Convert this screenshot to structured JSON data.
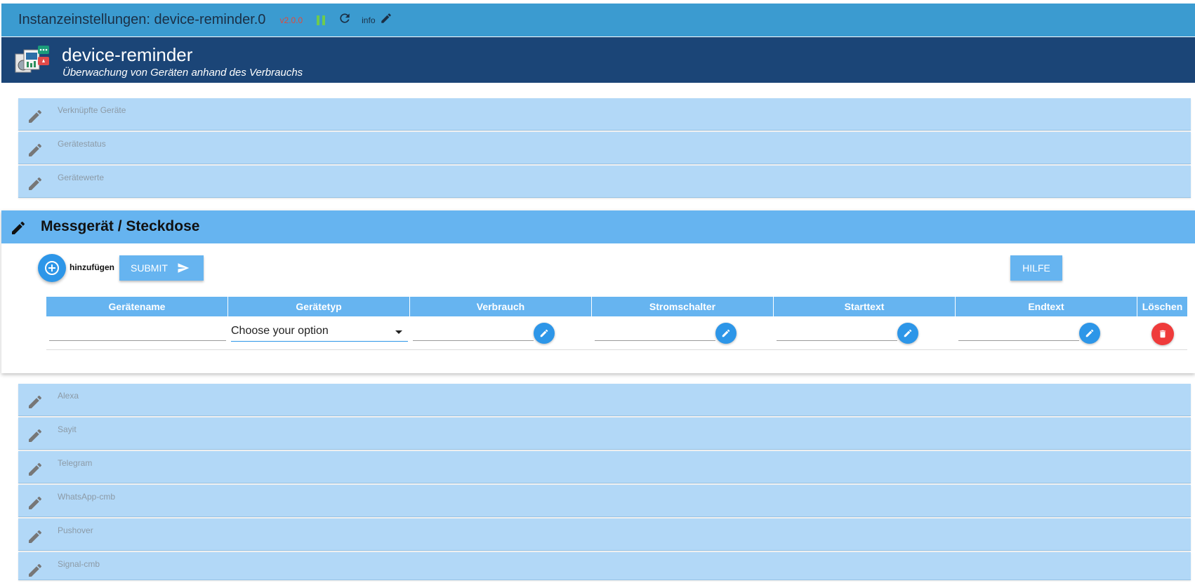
{
  "topbar": {
    "title": "Instanzeinstellungen: device-reminder.0",
    "version": "v2.0.0",
    "info": "info"
  },
  "app": {
    "name": "device-reminder",
    "subtitle": "Überwachung von Geräten anhand des Verbrauchs"
  },
  "sections_top": [
    {
      "label": "Verknüpfte Geräte"
    },
    {
      "label": "Gerätestatus"
    },
    {
      "label": "Gerätewerte"
    }
  ],
  "active_section": {
    "title": "Messgerät / Steckdose",
    "add_label": "hinzufügen",
    "submit_label": "SUBMIT",
    "help_label": "HILFE",
    "columns": [
      "Gerätename",
      "Gerätetyp",
      "Verbrauch",
      "Stromschalter",
      "Starttext",
      "Endtext",
      "Löschen"
    ],
    "row": {
      "geraetename": "",
      "geraetetyp": "Choose your option",
      "verbrauch": "",
      "stromschalter": "",
      "starttext": "",
      "endtext": ""
    }
  },
  "sections_bottom": [
    {
      "label": "Alexa"
    },
    {
      "label": "Sayit"
    },
    {
      "label": "Telegram"
    },
    {
      "label": "WhatsApp-cmb"
    },
    {
      "label": "Pushover"
    },
    {
      "label": "Signal-cmb"
    }
  ],
  "colors": {
    "topbar": "#3b9bd0",
    "header": "#1b4577",
    "section": "#b2d8f7",
    "active": "#66b4f0",
    "fab": "#2d96e8",
    "delete": "#ef3b3b",
    "version": "#e04a3b",
    "pause": "#6ecb4e"
  }
}
